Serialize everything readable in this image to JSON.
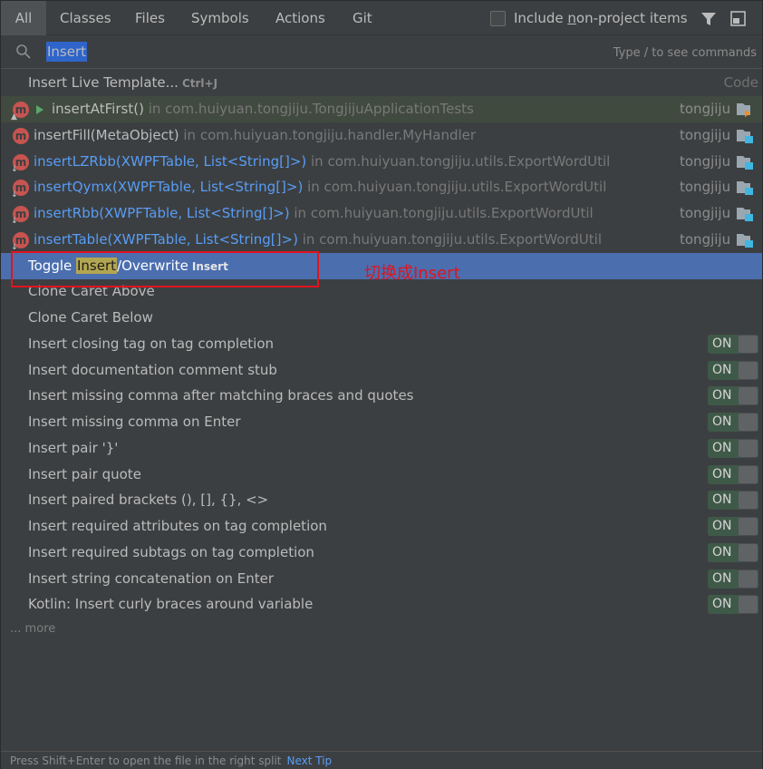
{
  "tabs": [
    {
      "label": "All"
    },
    {
      "label": "Classes"
    },
    {
      "label": "Files"
    },
    {
      "label": "Symbols"
    },
    {
      "label": "Actions"
    },
    {
      "label": "Git"
    }
  ],
  "toolbar": {
    "include_nonproject_prefix": "Include ",
    "include_nonproject_mnemonic": "n",
    "include_nonproject_rest": "on-project items",
    "include_nonproject_checked": false,
    "filter_icon": "funnel-icon",
    "pin_icon": "pin-window-icon"
  },
  "search": {
    "value": "Insert",
    "hint": "Type / to see commands"
  },
  "live_template": {
    "label": "Insert Live Template...",
    "shortcut": "Ctrl+J",
    "group": "Code"
  },
  "symbols": [
    {
      "name": "insertAtFirst()",
      "location": " in com.huiyuan.tongjiju.TongjijuApplicationTests",
      "module": "tongjiju",
      "link": false
    },
    {
      "name": "insertFill(MetaObject)",
      "location": " in com.huiyuan.tongjiju.handler.MyHandler",
      "module": "tongjiju",
      "link": false
    },
    {
      "name": "insertLZRbb(XWPFTable, List<String[]>)",
      "location": " in com.huiyuan.tongjiju.utils.ExportWordUtil",
      "module": "tongjiju",
      "link": true
    },
    {
      "name": "insertQymx(XWPFTable, List<String[]>)",
      "location": " in com.huiyuan.tongjiju.utils.ExportWordUtil",
      "module": "tongjiju",
      "link": true
    },
    {
      "name": "insertRbb(XWPFTable, List<String[]>)",
      "location": " in com.huiyuan.tongjiju.utils.ExportWordUtil",
      "module": "tongjiju",
      "link": true
    },
    {
      "name": "insertTable(XWPFTable, List<String[]>)",
      "location": " in com.huiyuan.tongjiju.utils.ExportWordUtil",
      "module": "tongjiju",
      "link": true
    }
  ],
  "toggle_action": {
    "prefix": "Toggle ",
    "highlight": "Insert",
    "suffix": "/Overwrite",
    "shortcut": "Insert"
  },
  "actions": [
    {
      "label": "Clone Caret Above"
    },
    {
      "label": "Clone Caret Below"
    }
  ],
  "options": [
    {
      "label": "Insert closing tag on tag completion",
      "state": "ON"
    },
    {
      "label": "Insert documentation comment stub",
      "state": "ON"
    },
    {
      "label": "Insert missing comma after matching braces and quotes",
      "state": "ON"
    },
    {
      "label": "Insert missing comma on Enter",
      "state": "ON"
    },
    {
      "label": "Insert pair '}'",
      "state": "ON"
    },
    {
      "label": "Insert pair quote",
      "state": "ON"
    },
    {
      "label": "Insert paired brackets (), [], {}, <>",
      "state": "ON"
    },
    {
      "label": "Insert required attributes on tag completion",
      "state": "ON"
    },
    {
      "label": "Insert required subtags on tag completion",
      "state": "ON"
    },
    {
      "label": "Insert string concatenation on Enter",
      "state": "ON"
    },
    {
      "label": "Kotlin: Insert curly braces around variable",
      "state": "ON"
    }
  ],
  "more": "... more",
  "annotation": "切换成Insert",
  "status": {
    "text": "Press Shift+Enter to open the file in the right split",
    "link": "Next Tip"
  },
  "colors": {
    "selection": "#4b6eaf",
    "annotation": "#e0141e",
    "link": "#589df6",
    "match_highlight": "#b3a650"
  }
}
